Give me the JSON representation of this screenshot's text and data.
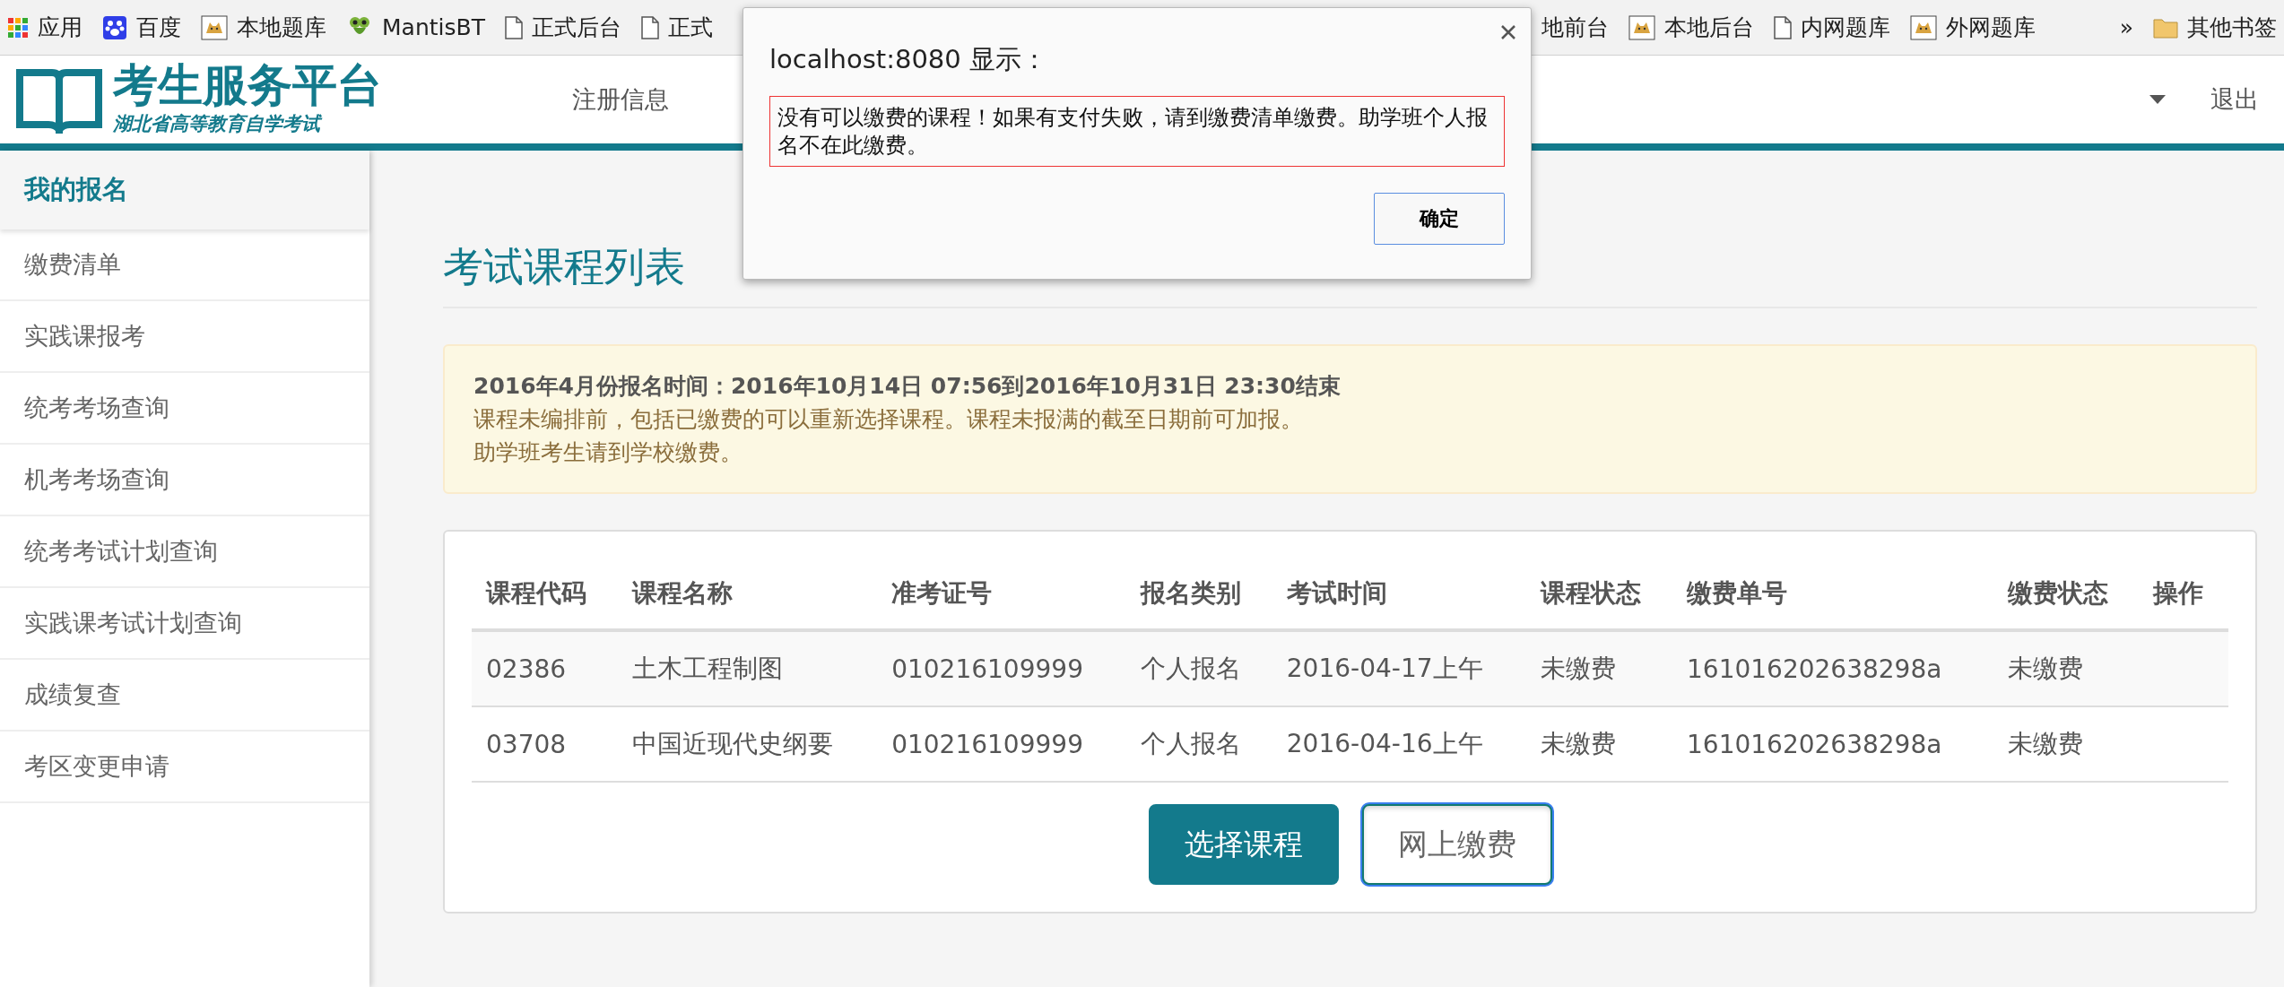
{
  "bookmarks": {
    "items": [
      {
        "label": "应用",
        "kind": "apps"
      },
      {
        "label": "百度",
        "kind": "paw"
      },
      {
        "label": "本地题库",
        "kind": "cat"
      },
      {
        "label": "MantisBT",
        "kind": "mantis"
      },
      {
        "label": "正式后台",
        "kind": "page"
      },
      {
        "label": "正式",
        "kind": "page"
      },
      {
        "label": "地前台",
        "kind": "none"
      },
      {
        "label": "本地后台",
        "kind": "cat"
      },
      {
        "label": "内网题库",
        "kind": "page"
      },
      {
        "label": "外网题库",
        "kind": "cat"
      }
    ],
    "overflow": "»",
    "other": {
      "label": "其他书签",
      "kind": "folder"
    }
  },
  "header": {
    "logo_title": "考生服务平台",
    "logo_subtitle": "湖北省高等教育自学考试",
    "nav": [
      {
        "label": "注册信息"
      }
    ],
    "logout": "退出"
  },
  "sidebar": {
    "title": "我的报名",
    "items": [
      {
        "label": "缴费清单"
      },
      {
        "label": "实践课报考"
      },
      {
        "label": "统考考场查询"
      },
      {
        "label": "机考考场查询"
      },
      {
        "label": "统考考试计划查询"
      },
      {
        "label": "实践课考试计划查询"
      },
      {
        "label": "成绩复查"
      },
      {
        "label": "考区变更申请"
      }
    ]
  },
  "page_title": "考试课程列表",
  "notice": {
    "heading": "2016年4月份报名时间：2016年10月14日 07:56到2016年10月31日 23:30结束",
    "lines": [
      "课程未编排前，包括已缴费的可以重新选择课程。课程未报满的截至日期前可加报。",
      "助学班考生请到学校缴费。"
    ]
  },
  "table": {
    "columns": [
      "课程代码",
      "课程名称",
      "准考证号",
      "报名类别",
      "考试时间",
      "课程状态",
      "缴费单号",
      "缴费状态",
      "操作"
    ],
    "rows": [
      [
        "02386",
        "土木工程制图",
        "010216109999",
        "个人报名",
        "2016-04-17上午",
        "未缴费",
        "161016202638298a",
        "未缴费"
      ],
      [
        "03708",
        "中国近现代史纲要",
        "010216109999",
        "个人报名",
        "2016-04-16上午",
        "未缴费",
        "161016202638298a",
        "未缴费"
      ]
    ]
  },
  "buttons": [
    {
      "label": "选择课程",
      "kind": "primary",
      "focused": false
    },
    {
      "label": "网上缴费",
      "kind": "default",
      "focused": true
    }
  ],
  "dialog": {
    "title": "localhost:8080 显示：",
    "message": "没有可以缴费的课程！如果有支付失败，请到缴费清单缴费。助学班个人报名不在此缴费。",
    "ok": "确定"
  }
}
